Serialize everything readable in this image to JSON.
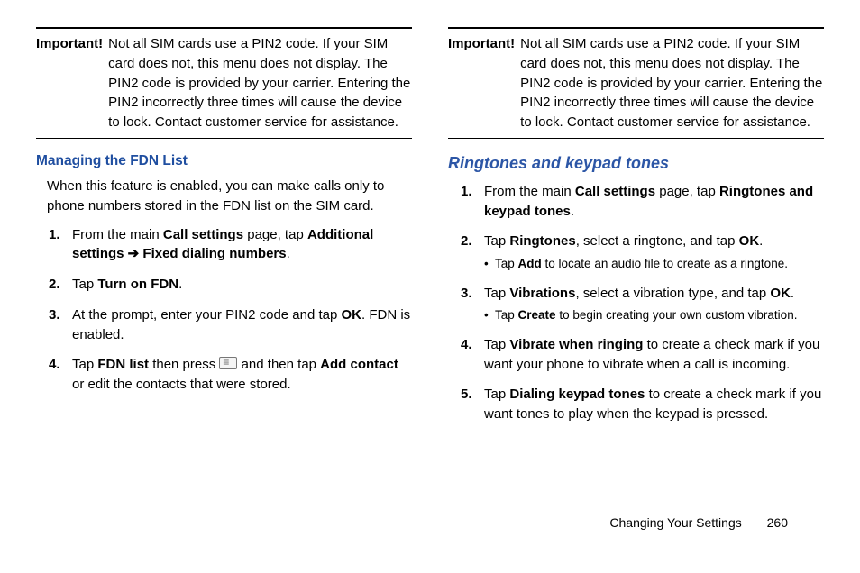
{
  "left": {
    "important_label": "Important!",
    "important_text": "Not all SIM cards use a PIN2 code. If your SIM card does not, this menu does not display. The PIN2 code is provided by your carrier. Entering the PIN2 incorrectly three times will cause the device to lock. Contact customer service for assistance.",
    "heading": "Managing the FDN List",
    "intro": "When this feature is enabled, you can make calls only to phone numbers stored in the FDN list on the SIM card.",
    "step1_pre": "From the main ",
    "step1_b1": "Call settings",
    "step1_mid": " page, tap ",
    "step1_b2": "Additional settings",
    "step1_arrow": " ➔ ",
    "step1_b3": "Fixed dialing numbers",
    "step1_end": ".",
    "step2_pre": "Tap ",
    "step2_b1": "Turn on FDN",
    "step2_end": ".",
    "step3_pre": "At the prompt, enter your PIN2 code and tap ",
    "step3_b1": "OK",
    "step3_end": ". FDN is enabled.",
    "step4_pre": "Tap ",
    "step4_b1": "FDN list",
    "step4_mid1": " then press ",
    "step4_mid2": " and then tap ",
    "step4_b2": "Add contact",
    "step4_end": " or edit the contacts that were stored."
  },
  "right": {
    "important_label": "Important!",
    "important_text": "Not all SIM cards use a PIN2 code. If your SIM card does not, this menu does not display. The PIN2 code is provided by your carrier. Entering the PIN2 incorrectly three times will cause the device to lock. Contact customer service for assistance.",
    "heading": "Ringtones and keypad tones",
    "step1_pre": "From the main ",
    "step1_b1": "Call settings",
    "step1_mid": " page, tap ",
    "step1_b2": "Ringtones and keypad tones",
    "step1_end": ".",
    "step2_pre": "Tap ",
    "step2_b1": "Ringtones",
    "step2_mid": ", select a ringtone, and tap ",
    "step2_b2": "OK",
    "step2_end": ".",
    "step2_sub_pre": "Tap ",
    "step2_sub_b": "Add",
    "step2_sub_end": " to locate an audio file to create as a ringtone.",
    "step3_pre": "Tap ",
    "step3_b1": "Vibrations",
    "step3_mid": ", select a vibration type, and tap ",
    "step3_b2": "OK",
    "step3_end": ".",
    "step3_sub_pre": "Tap ",
    "step3_sub_b": "Create",
    "step3_sub_end": " to begin creating your own custom vibration.",
    "step4_pre": "Tap ",
    "step4_b1": "Vibrate when ringing",
    "step4_end": " to create a check mark if you want your phone to vibrate when a call is incoming.",
    "step5_pre": " Tap ",
    "step5_b1": "Dialing keypad tones",
    "step5_end": " to create a check mark if you want tones to play when the keypad is pressed."
  },
  "footer": {
    "title": "Changing Your Settings",
    "page": "260"
  }
}
